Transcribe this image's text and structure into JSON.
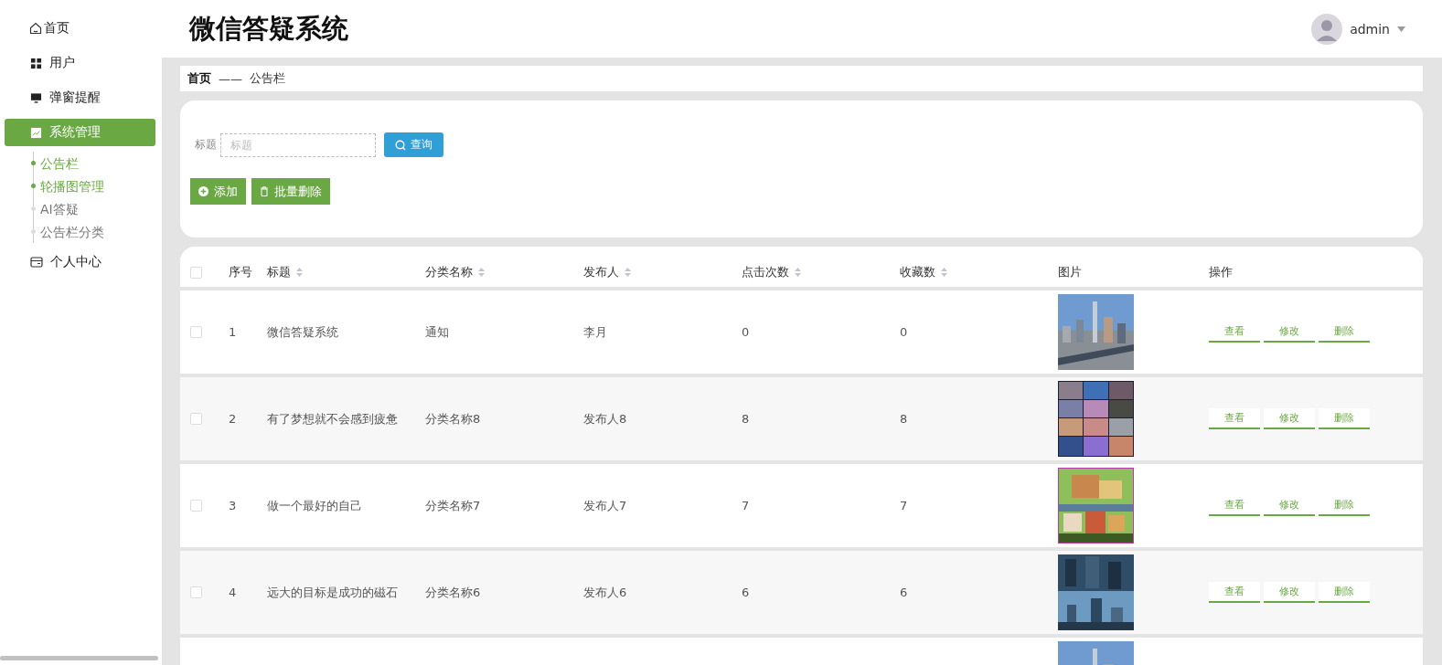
{
  "sidebar": {
    "items": [
      {
        "label": "首页",
        "selected": false
      },
      {
        "label": "用户",
        "selected": false
      },
      {
        "label": "弹窗提醒",
        "selected": false
      },
      {
        "label": "系统管理",
        "selected": true,
        "children": [
          {
            "label": "公告栏",
            "highlighted": true
          },
          {
            "label": "轮播图管理",
            "highlighted": true
          },
          {
            "label": "AI答疑",
            "highlighted": false
          },
          {
            "label": "公告栏分类",
            "highlighted": false
          }
        ]
      },
      {
        "label": "个人中心",
        "selected": false
      }
    ]
  },
  "header": {
    "title": "微信答疑系统",
    "user": "admin"
  },
  "breadcrumb": {
    "home": "首页",
    "separator": "——",
    "current": "公告栏"
  },
  "search": {
    "label": "标题",
    "placeholder": "标题",
    "button": "查询"
  },
  "actions": {
    "add": "添加",
    "batch_delete": "批量删除"
  },
  "table": {
    "all_checked": false,
    "columns": [
      {
        "label": "序号",
        "sortable": false
      },
      {
        "label": "标题",
        "sortable": true
      },
      {
        "label": "分类名称",
        "sortable": true
      },
      {
        "label": "发布人",
        "sortable": true
      },
      {
        "label": "点击次数",
        "sortable": true
      },
      {
        "label": "收藏数",
        "sortable": true
      },
      {
        "label": "图片",
        "sortable": false
      },
      {
        "label": "操作",
        "sortable": false
      }
    ],
    "rows": [
      {
        "index": "1",
        "title": "微信答疑系统",
        "category": "通知",
        "publisher": "李月",
        "clicks": "0",
        "favorites": "0",
        "checked": false,
        "actions": [
          "查看",
          "修改",
          "删除"
        ]
      },
      {
        "index": "2",
        "title": "有了梦想就不会感到疲惫",
        "category": "分类名称8",
        "publisher": "发布人8",
        "clicks": "8",
        "favorites": "8",
        "checked": false,
        "actions": [
          "查看",
          "修改",
          "删除"
        ]
      },
      {
        "index": "3",
        "title": "做一个最好的自己",
        "category": "分类名称7",
        "publisher": "发布人7",
        "clicks": "7",
        "favorites": "7",
        "checked": false,
        "actions": [
          "查看",
          "修改",
          "删除"
        ]
      },
      {
        "index": "4",
        "title": "远大的目标是成功的磁石",
        "category": "分类名称6",
        "publisher": "发布人6",
        "clicks": "6",
        "favorites": "6",
        "checked": false,
        "actions": [
          "查看",
          "修改",
          "删除"
        ]
      }
    ]
  }
}
